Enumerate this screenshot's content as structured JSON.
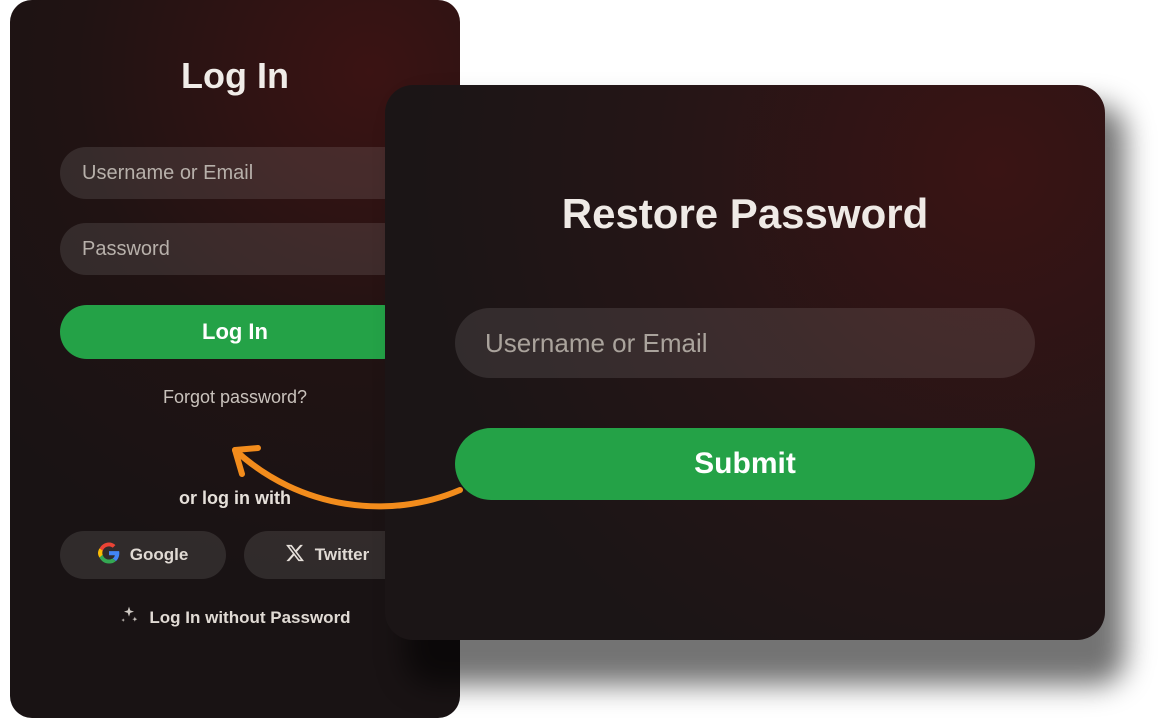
{
  "login": {
    "title": "Log In",
    "username_placeholder": "Username or Email",
    "password_placeholder": "Password",
    "login_button": "Log In",
    "forgot_link": "Forgot password?",
    "or_text": "or log in with",
    "google_label": "Google",
    "twitter_label": "Twitter",
    "passwordless_label": "Log In without Password"
  },
  "restore": {
    "title": "Restore Password",
    "username_placeholder": "Username or Email",
    "submit_button": "Submit"
  },
  "colors": {
    "primary_green": "#24a247",
    "card_bg_dark": "#1b1516",
    "card_bg_accent": "#3a1414",
    "arrow": "#f28c1c"
  }
}
